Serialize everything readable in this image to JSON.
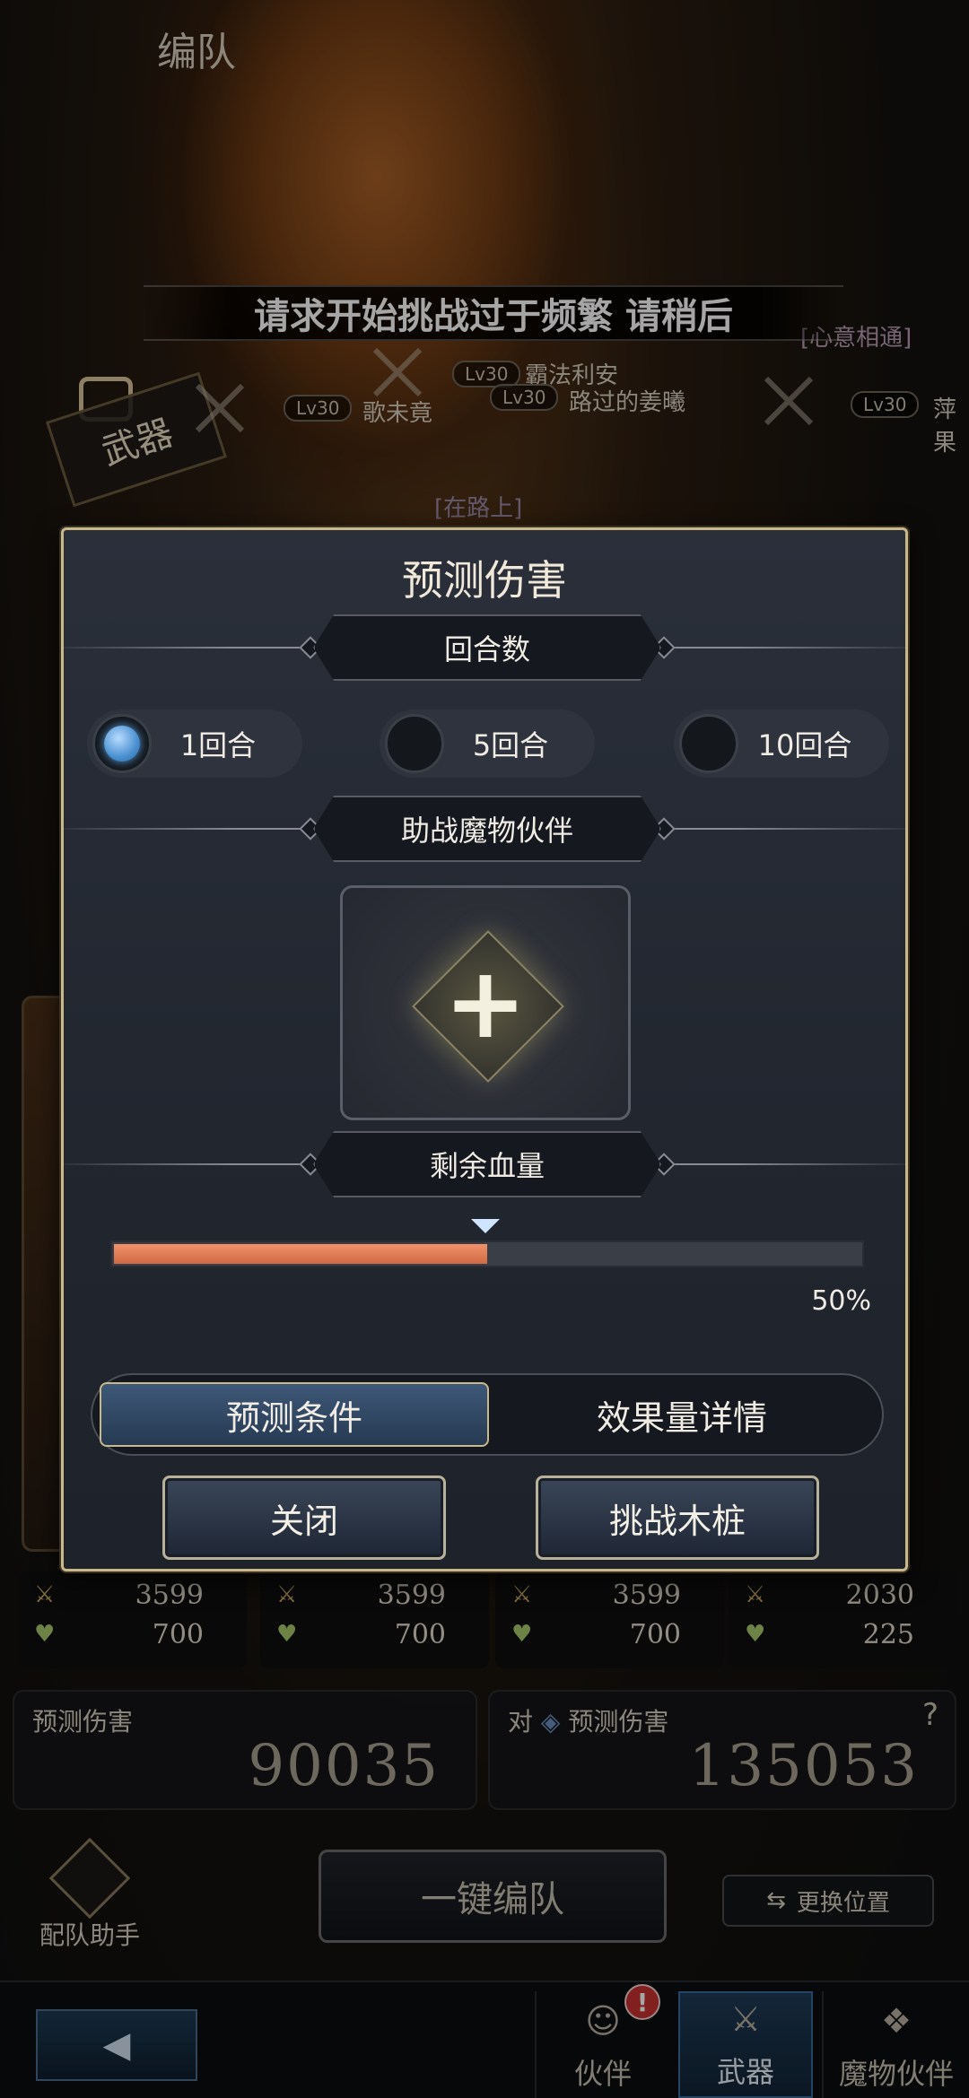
{
  "header": {
    "title": "编队"
  },
  "toast": "请求开始挑战过于频繁 请稍后",
  "background": {
    "weapon_tag": "武器",
    "characters": [
      {
        "level": "Lv30",
        "name": "歌未竟"
      },
      {
        "level": "Lv30",
        "name": "霸法利安"
      },
      {
        "level": "Lv30",
        "name": "路过的姜曦"
      },
      {
        "level": "Lv30",
        "name": "萍果"
      }
    ],
    "tags": {
      "heart": "[心意相通]",
      "on_road": "[在路上]"
    }
  },
  "stats": [
    {
      "attack": "3599",
      "hp": "700"
    },
    {
      "attack": "3599",
      "hp": "700"
    },
    {
      "attack": "3599",
      "hp": "700"
    },
    {
      "attack": "2030",
      "hp": "225"
    }
  ],
  "damage": {
    "left_label": "预测伤害",
    "left_value": "90035",
    "right_prefix": "对",
    "right_label": "预测伤害",
    "right_value": "135053",
    "help": "?"
  },
  "bottom": {
    "assistant_label": "配队助手",
    "one_click_label": "一键编队",
    "swap_label": "更换位置",
    "nav": [
      {
        "label": "伙伴",
        "icon": "partner-icon",
        "badge": "!"
      },
      {
        "label": "武器",
        "icon": "weapon-icon"
      },
      {
        "label": "魔物伙伴",
        "icon": "monster-icon"
      }
    ]
  },
  "modal": {
    "title": "预测伤害",
    "rounds_heading": "回合数",
    "rounds": [
      "1回合",
      "5回合",
      "10回合"
    ],
    "selected_round": 0,
    "partner_heading": "助战魔物伙伴",
    "hp_heading": "剩余血量",
    "hp_percent": 50,
    "hp_percent_label": "50%",
    "tabs": [
      "预测条件",
      "效果量详情"
    ],
    "active_tab": 0,
    "close_label": "关闭",
    "challenge_label": "挑战木桩"
  },
  "colors": {
    "accent_gold": "#c8b88a",
    "hp_fill": "#e27d56",
    "radio_selected": "#4a90d0",
    "active_nav": "#1e3a56"
  }
}
